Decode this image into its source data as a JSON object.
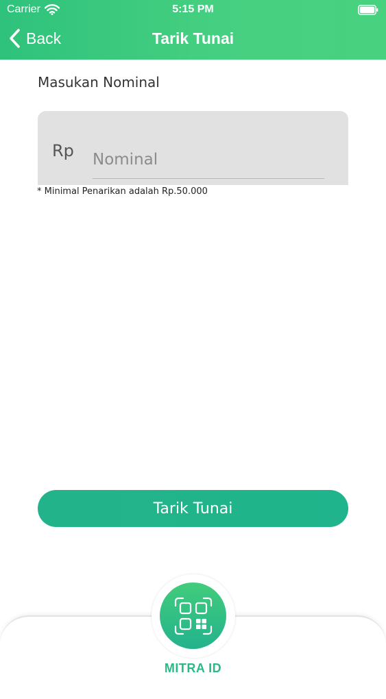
{
  "status_bar": {
    "carrier": "Carrier",
    "time": "5:15 PM"
  },
  "nav": {
    "back_label": "Back",
    "title": "Tarik Tunai"
  },
  "form": {
    "section_label": "Masukan Nominal",
    "currency": "Rp",
    "amount_placeholder": "Nominal",
    "amount_value": "",
    "min_note": "* Minimal Penarikan adalah Rp.50.000"
  },
  "actions": {
    "submit_label": "Tarik Tunai"
  },
  "tab_bar": {
    "center_label": "MITRA ID",
    "center_icon": "qr-code-icon"
  },
  "colors": {
    "header_green": "#45cf80",
    "button_green": "#1fb48b",
    "label_green": "#2bb985",
    "input_bg": "#e2e1e2"
  }
}
